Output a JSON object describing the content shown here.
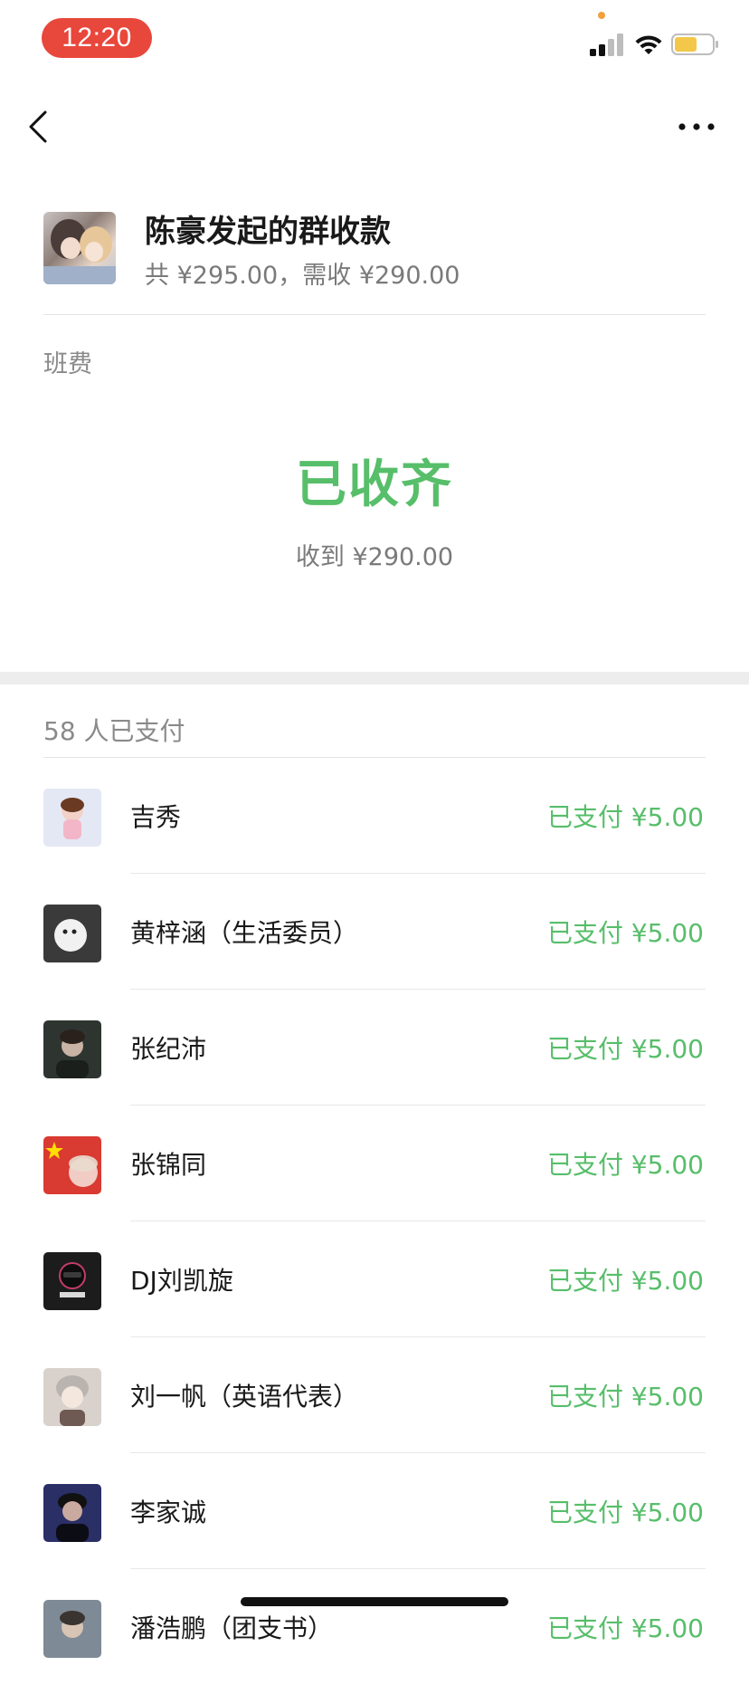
{
  "status_bar": {
    "time": "12:20",
    "accent_colors": {
      "time_pill": "#e8473c",
      "privacy_dot": "#f2a03d",
      "battery_fill": "#f3c84a"
    }
  },
  "nav": {
    "back_icon": "chevron-left-icon",
    "more_icon": "ellipsis-icon"
  },
  "header": {
    "title": "陈豪发起的群收款",
    "subtitle": "共 ¥295.00，需收 ¥290.00"
  },
  "note": "班费",
  "collection": {
    "status": "已收齐",
    "received": "收到 ¥290.00"
  },
  "paid_section": {
    "count_label": "58 人已支付"
  },
  "payers": [
    {
      "name": "吉秀",
      "status": "已支付 ¥5.00",
      "avatar_color": "#e4e8f4"
    },
    {
      "name": "黄梓涵（生活委员）",
      "status": "已支付 ¥5.00",
      "avatar_color": "#cfcfcf"
    },
    {
      "name": "张纪沛",
      "status": "已支付 ¥5.00",
      "avatar_color": "#2e3530"
    },
    {
      "name": "张锦同",
      "status": "已支付 ¥5.00",
      "avatar_color": "#d93a32"
    },
    {
      "name": "DJ刘凯旋",
      "status": "已支付 ¥5.00",
      "avatar_color": "#1c1c1c"
    },
    {
      "name": "刘一帆（英语代表）",
      "status": "已支付 ¥5.00",
      "avatar_color": "#d9d2cc"
    },
    {
      "name": "李家诚",
      "status": "已支付 ¥5.00",
      "avatar_color": "#2a2f66"
    },
    {
      "name": "潘浩鹏（团支书）",
      "status": "已支付 ¥5.00",
      "avatar_color": "#7e8a96"
    }
  ],
  "theme": {
    "green": "#57be6a",
    "text_primary": "#191919",
    "text_secondary": "#7a7a7a"
  }
}
